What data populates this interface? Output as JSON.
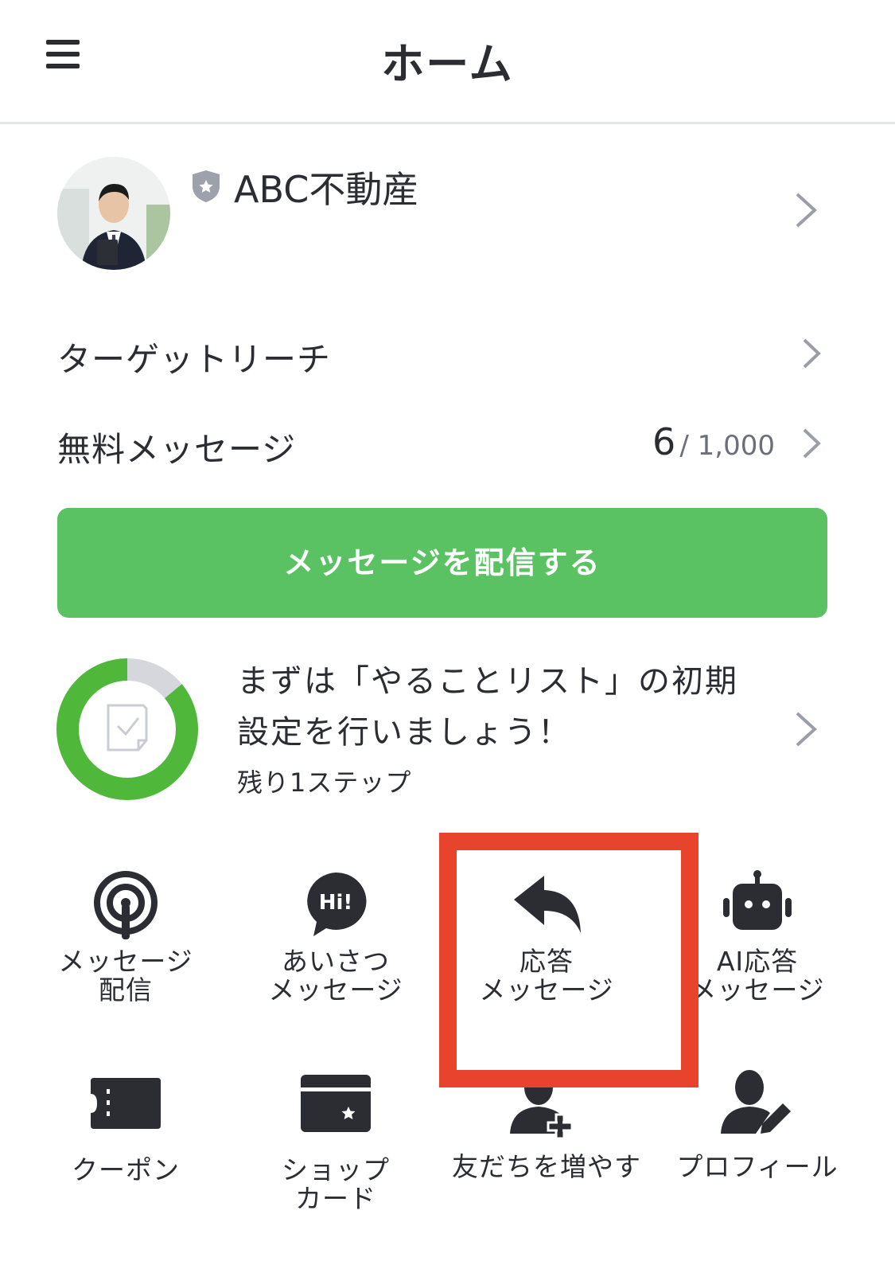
{
  "header": {
    "title": "ホーム",
    "menu_icon": "hamburger-menu-icon"
  },
  "account": {
    "name": "ABC不動産",
    "badge_icon": "verified-shield-icon",
    "avatar": "account-avatar"
  },
  "rows": {
    "target_reach": {
      "label": "ターゲットリーチ"
    },
    "free_messages": {
      "label": "無料メッセージ",
      "used": "6",
      "limit": "/ 1,000"
    }
  },
  "cta": {
    "label": "メッセージを配信する",
    "color": "#5ac263"
  },
  "todo": {
    "line1": "まずは「やることリスト」の初期",
    "line2": "設定を行いましょう！",
    "remaining": "残り1ステップ",
    "progress": 0.86
  },
  "tiles": [
    {
      "label": "メッセージ\n配信",
      "icon": "broadcast-icon"
    },
    {
      "label": "あいさつ\nメッセージ",
      "icon": "hi-greeting-icon"
    },
    {
      "label": "応答\nメッセージ",
      "icon": "reply-arrow-icon",
      "highlighted": true
    },
    {
      "label": "AI応答\nメッセージ",
      "icon": "robot-icon"
    },
    {
      "label": "クーポン",
      "icon": "coupon-icon"
    },
    {
      "label": "ショップ\nカード",
      "icon": "shop-card-icon"
    },
    {
      "label": "友だちを増やす",
      "icon": "add-friend-icon"
    },
    {
      "label": "プロフィール",
      "icon": "profile-edit-icon"
    }
  ],
  "colors": {
    "highlight": "#e8432c",
    "progress_fill": "#4fb83a",
    "progress_track": "#d5d7dc"
  }
}
